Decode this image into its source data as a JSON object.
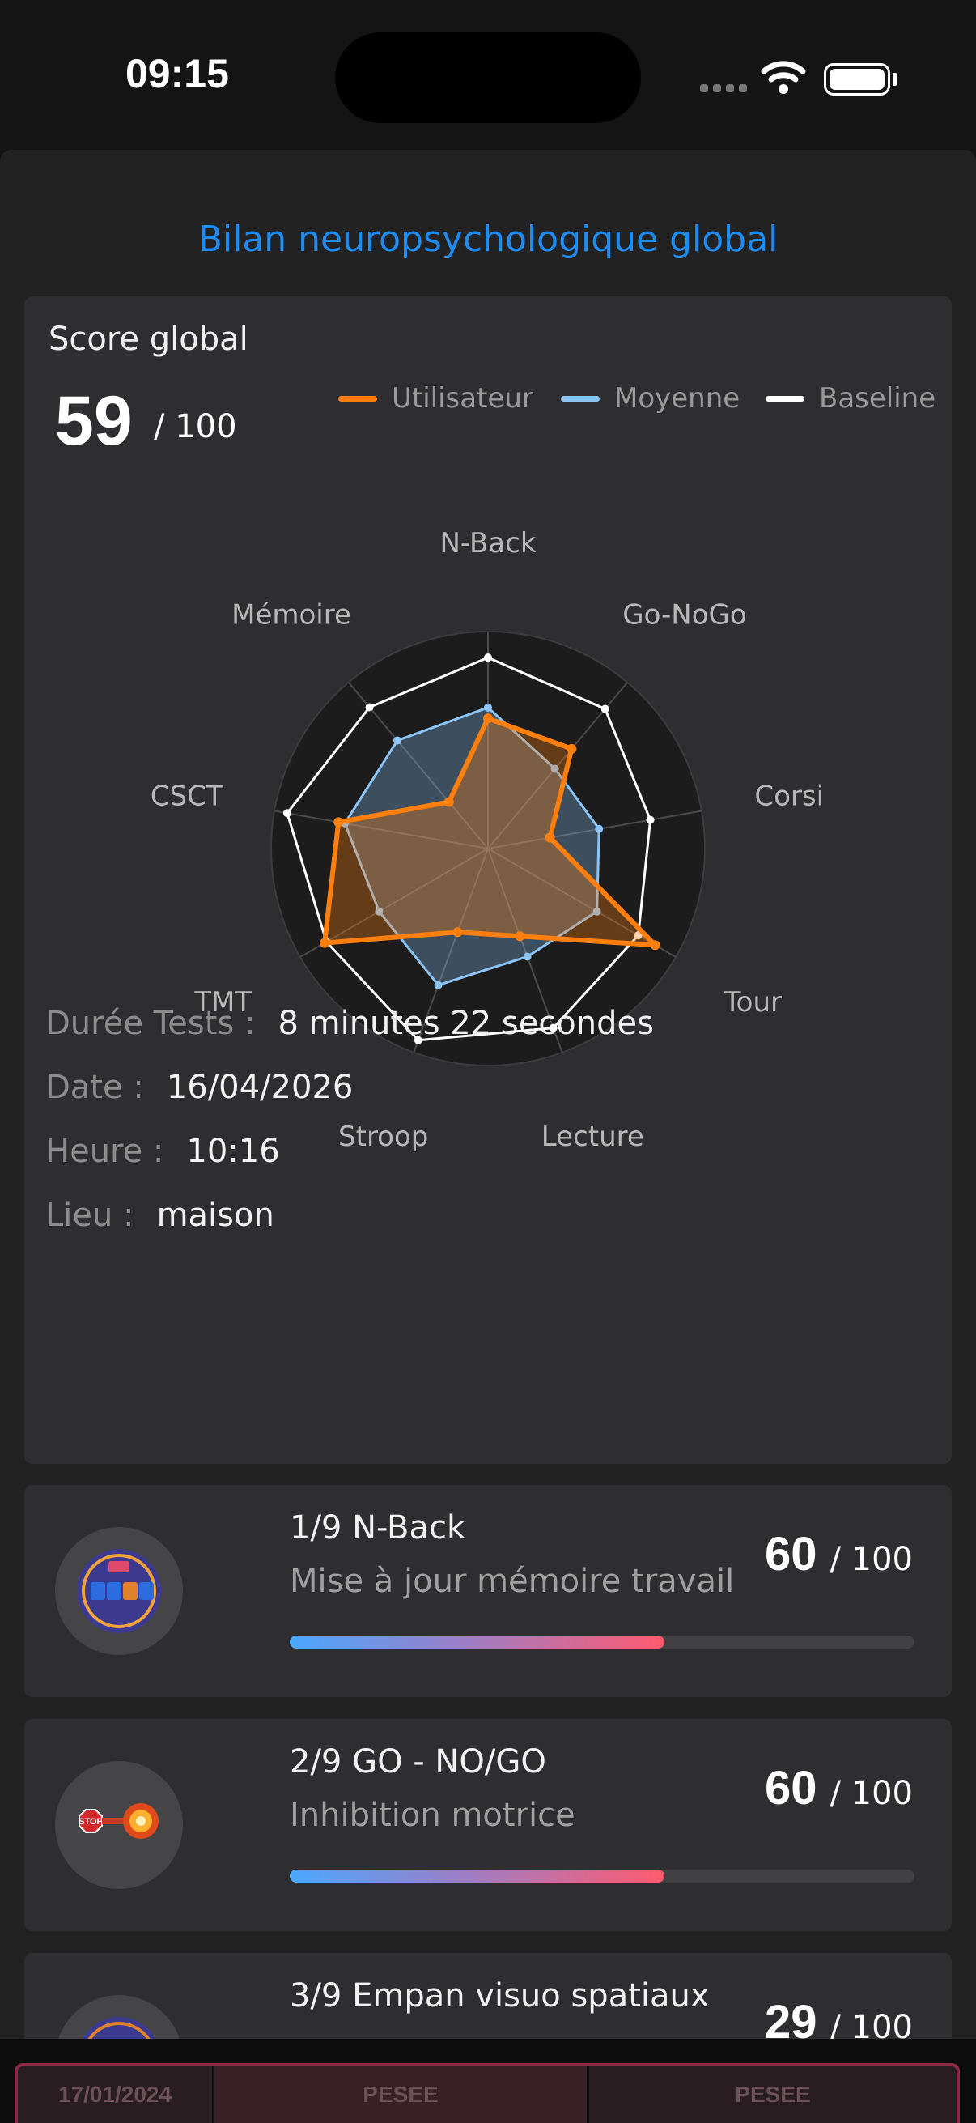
{
  "status": {
    "time": "09:15"
  },
  "page": {
    "title": "Bilan neuropsychologique global"
  },
  "global": {
    "label": "Score global",
    "score": "59",
    "max": "/ 100",
    "legend": [
      {
        "label": "Utilisateur",
        "color": "#ff7f0e"
      },
      {
        "label": "Moyenne",
        "color": "#8cc4f5"
      },
      {
        "label": "Baseline",
        "color": "#ffffff"
      }
    ]
  },
  "chart_data": {
    "type": "radar",
    "axes": [
      "N-Back",
      "Go-NoGo",
      "Corsi",
      "Tour",
      "Lecture",
      "Stroop",
      "TMT",
      "CSCT",
      "Mémoire"
    ],
    "range": [
      0,
      100
    ],
    "series": [
      {
        "name": "Utilisateur",
        "color": "#ff7f0e",
        "values": [
          60,
          60,
          29,
          89,
          43,
          41,
          87,
          70,
          28
        ]
      },
      {
        "name": "Moyenne",
        "color": "#8cc4f5",
        "values": [
          65,
          48,
          52,
          58,
          53,
          67,
          58,
          67,
          65
        ]
      },
      {
        "name": "Baseline",
        "color": "#ffffff",
        "values": [
          88,
          84,
          76,
          80,
          88,
          94,
          86,
          94,
          85
        ]
      }
    ]
  },
  "details": [
    {
      "key": "Durée Tests :",
      "value": "8 minutes 22 secondes"
    },
    {
      "key": "Date :",
      "value": "16/04/2026"
    },
    {
      "key": "Heure :",
      "value": "10:16"
    },
    {
      "key": "Lieu :",
      "value": "maison"
    }
  ],
  "tests": [
    {
      "title": "1/9 N-Back",
      "subtitle": "Mise à jour mémoire travail",
      "score": "60",
      "max": "/ 100",
      "progress": 0.6,
      "icon": "n-back-icon"
    },
    {
      "title": "2/9 GO - NO/GO",
      "subtitle": "Inhibition motrice",
      "score": "60",
      "max": "/ 100",
      "progress": 0.6,
      "icon": "stop-go-icon"
    },
    {
      "title": "3/9 Empan visuo spatiaux",
      "subtitle": "",
      "score": "29",
      "max": "/ 100",
      "progress": 0.29,
      "icon": "corsi-icon"
    }
  ],
  "bottom_tabs": [
    {
      "label": "17/01/2024"
    },
    {
      "label": "PESEE"
    },
    {
      "label": "PESEE"
    }
  ]
}
